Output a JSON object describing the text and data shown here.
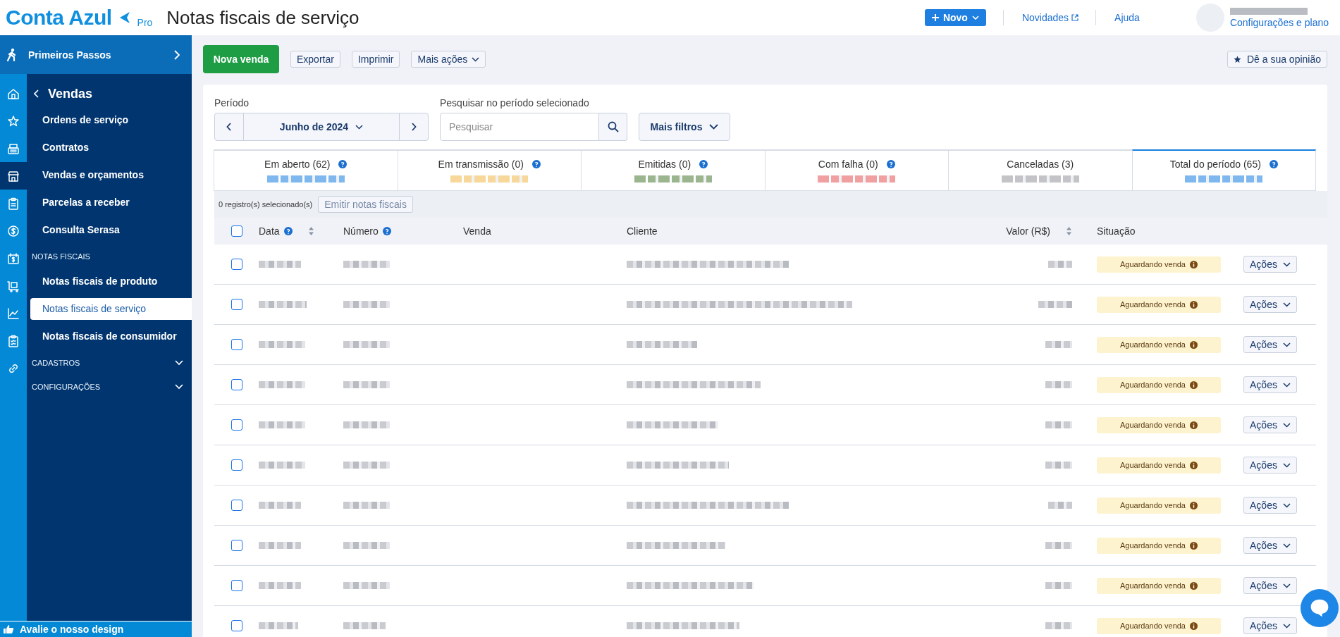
{
  "header": {
    "logo": "Conta Azul",
    "logo_badge": "Pro",
    "title": "Notas fiscais de serviço",
    "new_button": "Novo",
    "links": [
      {
        "label": "Novidades",
        "external": true
      },
      {
        "label": "Ajuda",
        "external": false
      }
    ],
    "account_link": "Configurações e plano"
  },
  "sidebar": {
    "onboarding": "Primeiros Passos",
    "rail": [
      {
        "kind": "home",
        "selected": false
      },
      {
        "kind": "star",
        "selected": false
      },
      {
        "kind": "register",
        "selected": false
      },
      {
        "kind": "store",
        "selected": true
      },
      {
        "kind": "clipboard",
        "selected": false
      },
      {
        "kind": "coin",
        "selected": false
      },
      {
        "kind": "calendar",
        "selected": false
      },
      {
        "kind": "cart",
        "selected": false
      },
      {
        "kind": "chart",
        "selected": false
      },
      {
        "kind": "checklist",
        "selected": false
      },
      {
        "kind": "link",
        "selected": false
      }
    ],
    "section": "Vendas",
    "groups": [
      {
        "items": [
          {
            "label": "Ordens de serviço",
            "selected": false
          },
          {
            "label": "Contratos",
            "selected": false
          },
          {
            "label": "Vendas e orçamentos",
            "selected": false
          },
          {
            "label": "Parcelas a receber",
            "selected": false
          },
          {
            "label": "Consulta Serasa",
            "selected": false
          }
        ]
      },
      {
        "heading": "NOTAS FISCAIS",
        "items": [
          {
            "label": "Notas fiscais de produto",
            "selected": false
          },
          {
            "label": "Notas fiscais de serviço",
            "selected": true
          },
          {
            "label": "Notas fiscais de consumidor",
            "selected": false
          }
        ]
      },
      {
        "heading": "CADASTROS",
        "expanded": false
      },
      {
        "heading": "CONFIGURAÇÕES",
        "expanded": false
      }
    ],
    "feedback": "Avalie o nosso design"
  },
  "toolbar": {
    "primary": "Nova venda",
    "buttons": [
      "Exportar",
      "Imprimir"
    ],
    "menu": "Mais ações",
    "opinion": "Dê a sua opinião"
  },
  "filters": {
    "period_label": "Período",
    "period": "Junho de 2024",
    "search_label": "Pesquisar no período selecionado",
    "search": {
      "placeholder": "Pesquisar"
    },
    "more": "Mais filtros"
  },
  "tabs": [
    {
      "label": "Em aberto (62)",
      "help": true,
      "selected": false,
      "color": "#7fb8ee"
    },
    {
      "label": "Em transmissão (0)",
      "help": true,
      "selected": false,
      "color": "#f7d79a"
    },
    {
      "label": "Emitidas (0)",
      "help": true,
      "selected": false,
      "color": "#9bb58e"
    },
    {
      "label": "Com falha (0)",
      "help": true,
      "selected": false,
      "color": "#f0a0a0"
    },
    {
      "label": "Canceladas (3)",
      "help": false,
      "selected": false,
      "color": "#c4c4c8"
    },
    {
      "label": "Total do período (65)",
      "help": true,
      "selected": true,
      "color": "#7fb8ee"
    }
  ],
  "selection": {
    "count": "0 registro(s) selecionado(s)",
    "action": "Emitir notas fiscais",
    "disabled": true
  },
  "table": {
    "select_all_checked": false,
    "columns": [
      {
        "label": "Data",
        "help": true,
        "sortable": true
      },
      {
        "label": "Número",
        "help": true,
        "sortable": false
      },
      {
        "label": "Venda",
        "help": false,
        "sortable": false
      },
      {
        "label": "Cliente",
        "help": false,
        "sortable": false
      },
      {
        "label": "Valor (R$)",
        "help": false,
        "sortable": true
      },
      {
        "label": "Situação",
        "help": false,
        "sortable": false
      }
    ],
    "rows": [
      {
        "checked": false,
        "status": "Aguardando venda",
        "action": "Ações"
      },
      {
        "checked": false,
        "status": "Aguardando venda",
        "action": "Ações"
      },
      {
        "checked": false,
        "status": "Aguardando venda",
        "action": "Ações"
      },
      {
        "checked": false,
        "status": "Aguardando venda",
        "action": "Ações"
      },
      {
        "checked": false,
        "status": "Aguardando venda",
        "action": "Ações"
      },
      {
        "checked": false,
        "status": "Aguardando venda",
        "action": "Ações"
      },
      {
        "checked": false,
        "status": "Aguardando venda",
        "action": "Ações"
      },
      {
        "checked": false,
        "status": "Aguardando venda",
        "action": "Ações"
      },
      {
        "checked": false,
        "status": "Aguardando venda",
        "action": "Ações"
      },
      {
        "checked": false,
        "status": "Aguardando venda",
        "action": "Ações"
      }
    ]
  }
}
